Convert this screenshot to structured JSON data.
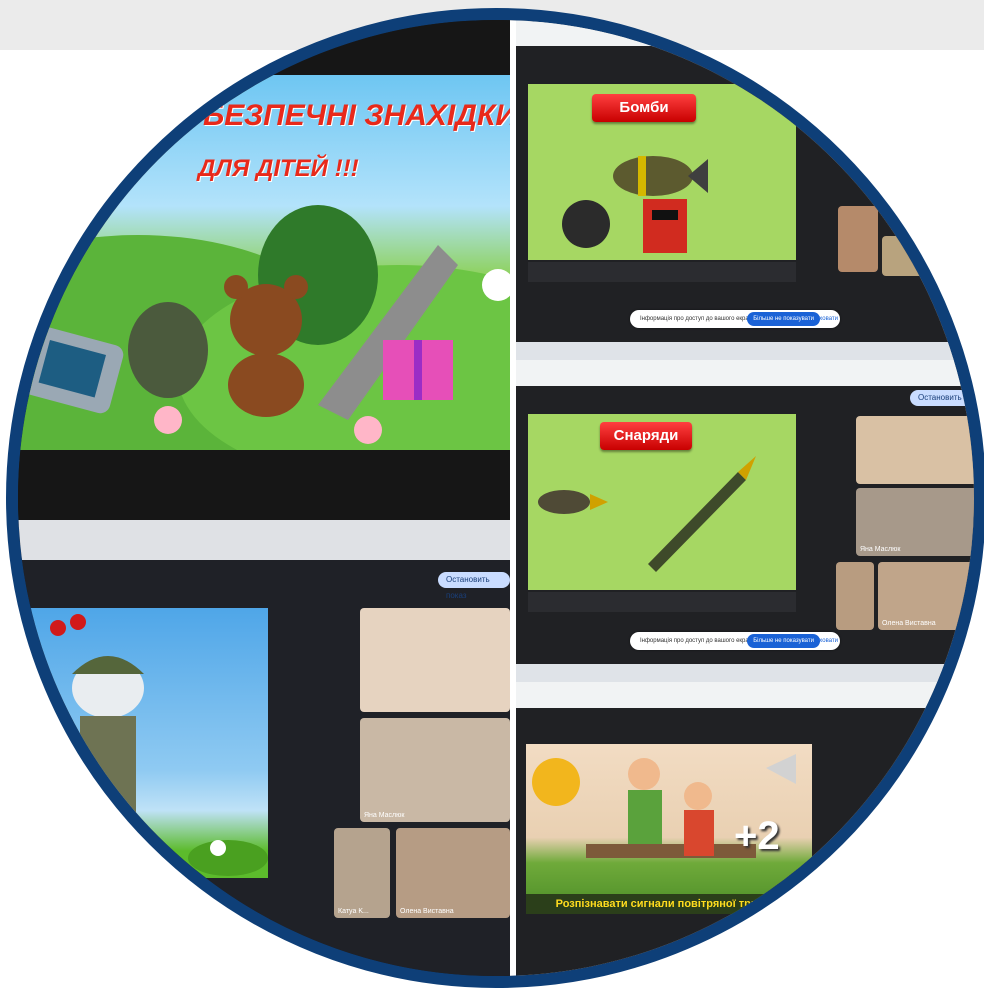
{
  "slides": {
    "main_title_line1": "БЕЗПЕЧНІ ЗНАХІДКИ",
    "main_title_line2": "ДЛЯ ДІТЕЙ !!!",
    "bombs_banner": "Бомби",
    "shells_banner": "Снаряди",
    "score": "+2",
    "air_raid_caption": "Розпізнавати сигнали повітряної тривоги"
  },
  "meet": {
    "stop_button": "Остановить показ",
    "notification": "Інформація про доступ до вашого екрана",
    "notification_ok": "Більше не показувати",
    "notification_close": "Сховати",
    "participants": [
      "Яна Маслюк",
      "Катya K...",
      "Олена Виставна"
    ]
  },
  "colors": {
    "frame": "#0e3f78",
    "slide_green": "#a6d763",
    "banner_red": "#e01212"
  }
}
